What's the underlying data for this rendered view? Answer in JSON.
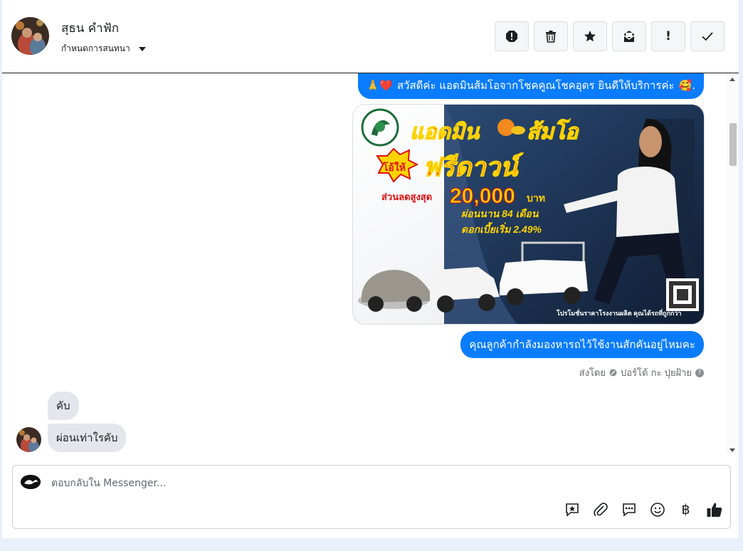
{
  "header": {
    "contact_name": "สุธน คำฟัก",
    "conversation_settings": "กำหนดการสนทนา",
    "actions": [
      "spam-icon",
      "trash-icon",
      "star-icon",
      "mark-unread-icon",
      "exclamation-icon",
      "check-icon"
    ],
    "action_exclaim_text": "!"
  },
  "messages": {
    "greeting_emoji": "🙏❤️",
    "greeting": "สวัสดีค่ะ แอดมินส้มโอจากโชคคูณโชคอุดร ยินดีให้บริการค่ะ",
    "greeting_end": "🥰.",
    "promo_image": {
      "title_part1": "แอดมิน",
      "title_part2": "ส้มโอ",
      "badge": "โอ้ให้",
      "headline": "ฟรีดาวน์",
      "discount_label": "ส่วนลดสูงสุด",
      "discount_amount": "20,000",
      "discount_unit": "บาท",
      "installment": "ผ่อนนาน 84 เดือน",
      "interest": "ดอกเบี้ยเริ่ม 2.49%",
      "footer": "โปรโมชั่นราคาโรงงานผลิต คุณได้รถที่ถูกกว่า"
    },
    "question": "คุณลูกค้ากำลังมองหารถไว้ใช้งานสักคันอยู่ไหมคะ",
    "sent_by": "ส่งโดย",
    "sent_by_name": "ปอร์โต้ กะ ปุยฝ้าย",
    "sent_by_help": "?",
    "reply_1": "คับ",
    "reply_2": "ผ่อนเท่าใรคับ"
  },
  "composer": {
    "placeholder": "ตอบกลับใน Messenger...",
    "tools": [
      "saved-reply-icon",
      "attachment-icon",
      "chat-icon",
      "emoji-icon",
      "baht-icon",
      "thumbs-up-icon"
    ],
    "baht_symbol": "฿"
  },
  "colors": {
    "accent": "#0a7cff",
    "incoming_bubble": "#e4e6eb",
    "page_background": "#eaf0fb",
    "promo_red": "#e01010",
    "promo_yellow": "#ffd400"
  }
}
